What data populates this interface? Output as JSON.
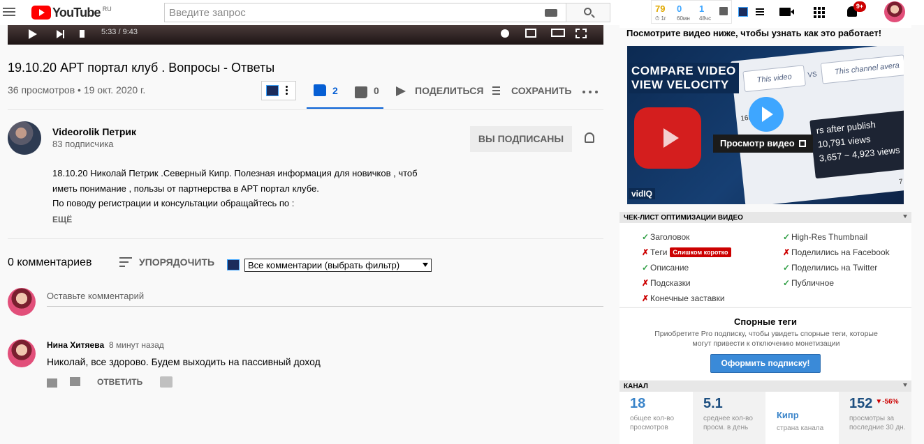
{
  "header": {
    "logo_text": "YouTube",
    "region": "RU",
    "search_placeholder": "Введите запрос",
    "vidiq_stats": [
      {
        "value": "79",
        "label": "1г",
        "color": "#e0a800"
      },
      {
        "value": "0",
        "label": "60мн",
        "color": "#3ea6ff"
      },
      {
        "value": "1",
        "label": "48чс",
        "color": "#3ea6ff"
      }
    ],
    "notifications_badge": "9+"
  },
  "player": {
    "time": "5:33 / 9:43"
  },
  "video": {
    "title": "19.10.20 АРТ портал клуб . Вопросы - Ответы",
    "meta": "36 просмотров • 19 окт. 2020 г.",
    "likes": "2",
    "dislikes": "0",
    "share_label": "ПОДЕЛИТЬСЯ",
    "save_label": "СОХРАНИТЬ",
    "like_ratio": 1.0
  },
  "channel": {
    "name": "Videorolik Петрик",
    "subscribers": "83 подписчика",
    "subscribe_label": "ВЫ ПОДПИСАНЫ",
    "description_lines": [
      "18.10.20 Николай Петрик .Северный Кипр.  Полезная информация для новичков , чтоб",
      "иметь понимание , пользы от партнерства в АРТ портал клубе.",
      "По поводу регистрации и консультации обращайтесь по :"
    ],
    "more_label": "ЕЩЁ"
  },
  "comments": {
    "count_label": "0 комментариев",
    "sort_label": "УПОРЯДОЧИТЬ",
    "filter_value": "Все комментарии (выбрать фильтр)",
    "input_placeholder": "Оставьте комментарий",
    "items": [
      {
        "author": "Нина Хитяева",
        "time": "8 минут назад",
        "text": "Николай, все здорово. Будем выходить на пассивный доход",
        "reply_label": "ОТВЕТИТЬ"
      }
    ]
  },
  "sidebar": {
    "promo_text": "Посмотрите видео ниже, чтобы узнать как это работает!",
    "thumb_headline_1": "COMPARE VIDEO",
    "thumb_headline_2": "VIEW VELOCITY",
    "thumb_brand": "vidIQ",
    "thumb_chip_1": "This video",
    "thumb_chip_2": "This channel avera",
    "thumb_vs": "VS",
    "thumb_16k": "16K",
    "thumb_7": "7",
    "thumb_tag_1": "rs after publish",
    "thumb_tag_2": "10,791 views",
    "thumb_tag_3": "3,657 ~ 4,923 views",
    "watch_cta": "Просмотр видео",
    "checklist_title": "ЧЕК-ЛИСТ ОПТИМИЗАЦИИ ВИДЕО",
    "checklist_left": [
      {
        "label": "Заголовок",
        "ok": true
      },
      {
        "label": "Теги",
        "ok": false,
        "badge": "Слишком коротко"
      },
      {
        "label": "Описание",
        "ok": true
      },
      {
        "label": "Подсказки",
        "ok": false
      },
      {
        "label": "Конечные заставки",
        "ok": false
      }
    ],
    "checklist_right": [
      {
        "label": "High-Res Thumbnail",
        "ok": true
      },
      {
        "label": "Поделились на Facebook",
        "ok": false
      },
      {
        "label": "Поделились на Twitter",
        "ok": true
      },
      {
        "label": "Публичное",
        "ok": true
      }
    ],
    "tags_title": "Спорные теги",
    "tags_desc": "Приобретите Pro подписку, чтобы увидеть спорные теги, которые могут привести к отключению монетизации",
    "pro_button": "Оформить подписку!",
    "channel_title": "КАНАЛ",
    "channel_stats": [
      {
        "value": "18",
        "label": "общее кол-во просмотров"
      },
      {
        "value": "5.1",
        "label": "среднее кол-во просм. в день"
      },
      {
        "value": "Кипр",
        "label": "страна канала"
      },
      {
        "value": "152",
        "label": "просмотры за последние 30 дн.",
        "trend": "▼-56%"
      }
    ]
  }
}
